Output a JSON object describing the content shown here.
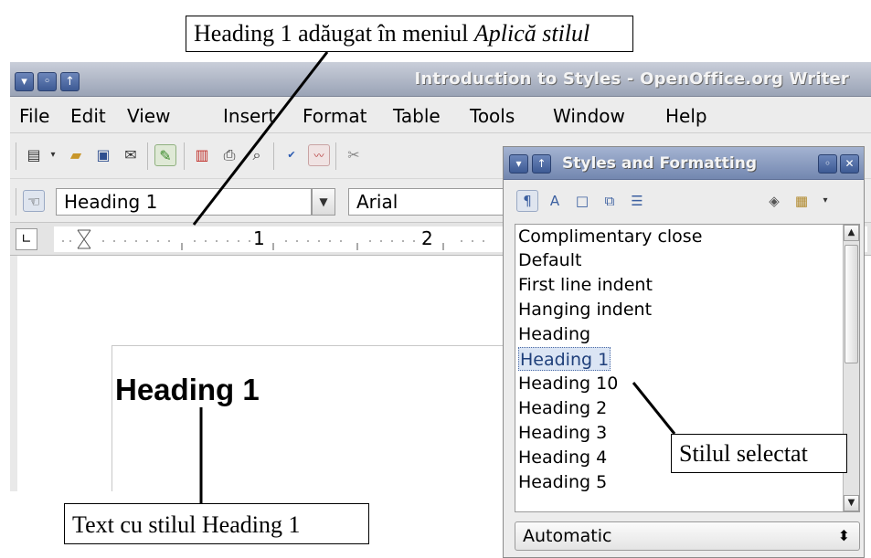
{
  "callouts": {
    "top_prefix": "Heading 1 adăugat în meniul ",
    "top_italic": "Aplică stilul",
    "bottom": "Text cu stilul Heading 1",
    "right": "Stilul selectat"
  },
  "window": {
    "title": "Introduction to Styles - OpenOffice.org Writer"
  },
  "menu": {
    "file": "File",
    "edit": "Edit",
    "view": "View",
    "insert": "Insert",
    "format": "Format",
    "table": "Table",
    "tools": "Tools",
    "window": "Window",
    "help": "Help"
  },
  "formatting": {
    "apply_style": "Heading 1",
    "font_name": "Arial"
  },
  "ruler": {
    "mark1": "1",
    "mark2": "2"
  },
  "document": {
    "heading_text": "Heading 1"
  },
  "styles_panel": {
    "title": "Styles and Formatting",
    "items": [
      "Complimentary close",
      "Default",
      "First line indent",
      "Hanging indent",
      "Heading",
      "Heading 1",
      "Heading 10",
      "Heading 2",
      "Heading 3",
      "Heading 4",
      "Heading 5"
    ],
    "selected_item": "Heading 1",
    "filter_value": "Automatic"
  },
  "icons": {
    "window_menu": "chevron-down-icon",
    "window_min": "minimize-icon",
    "window_max": "maximize-icon",
    "selected_highlight_color": "#dbe5f4"
  }
}
